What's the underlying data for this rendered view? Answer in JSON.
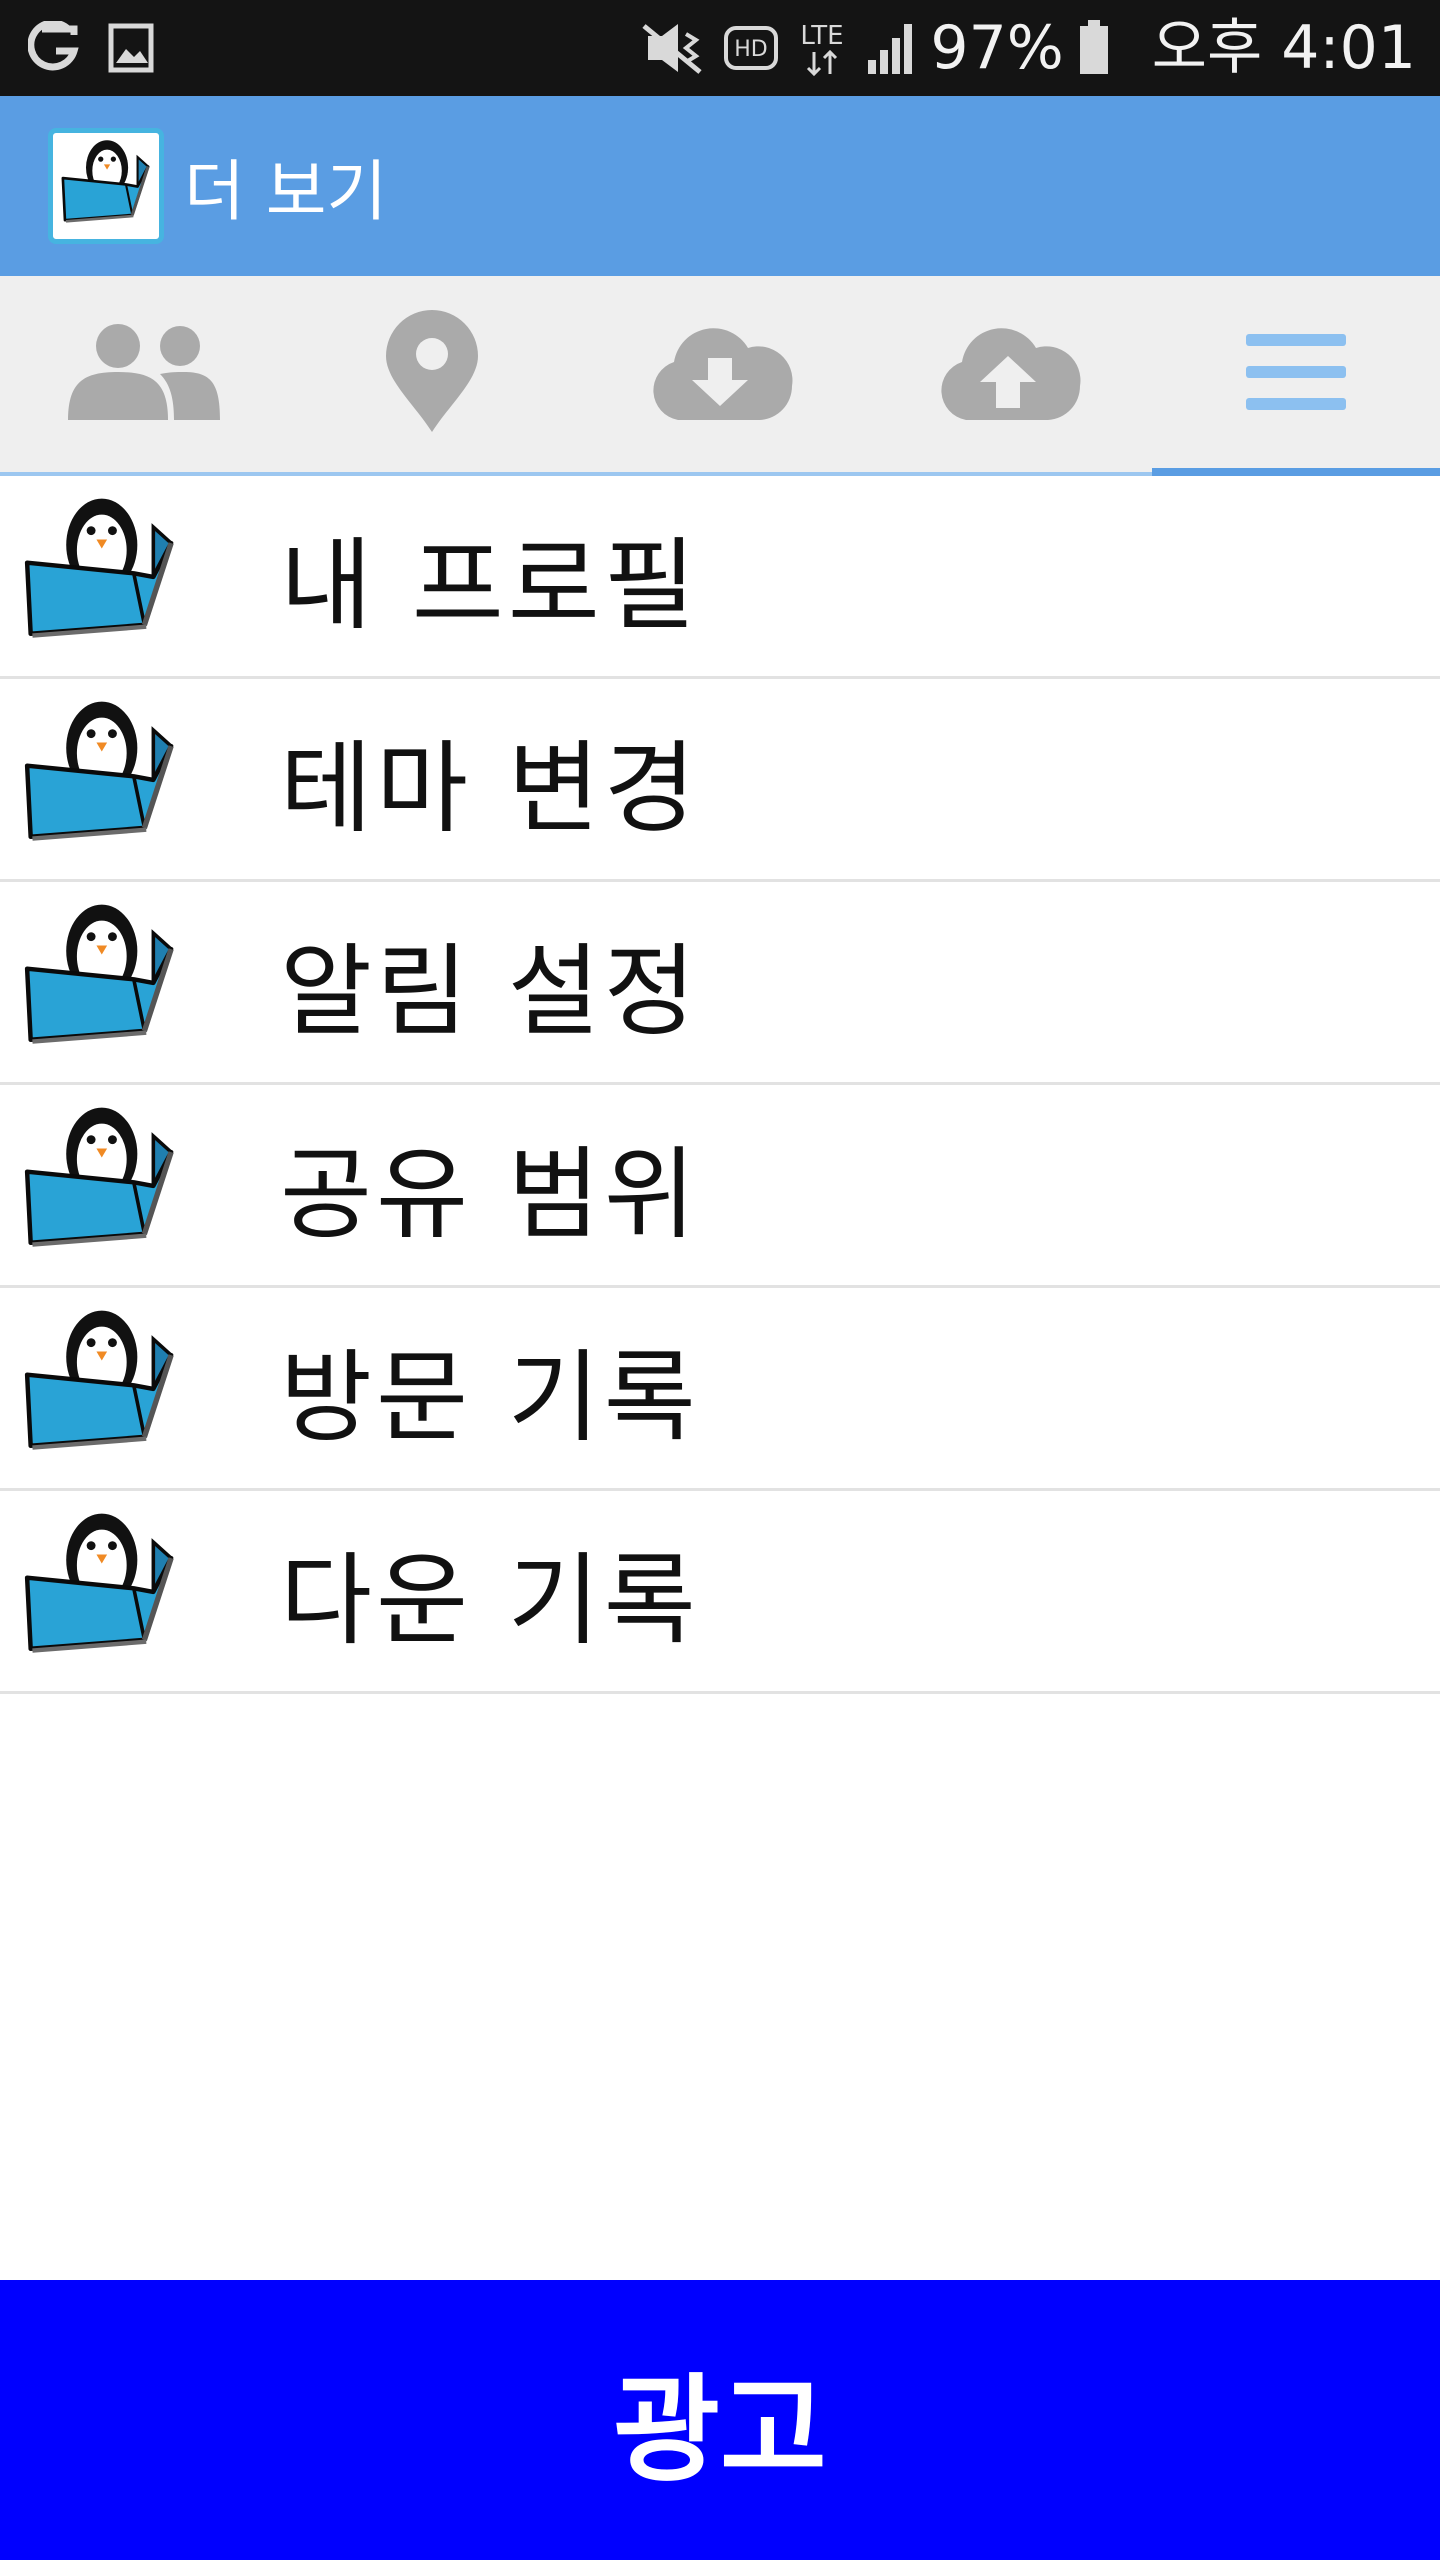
{
  "status_bar": {
    "battery_percent": "97%",
    "time": "오후 4:01",
    "icons": [
      "notification-g-icon",
      "gallery-icon",
      "mute-icon",
      "hd-icon",
      "lte-icon",
      "signal-icon",
      "battery-icon"
    ]
  },
  "app_bar": {
    "title": "더 보기",
    "logo_icon": "penguin-box-icon",
    "color": "#5a9de3"
  },
  "tabs": [
    {
      "icon": "people-icon",
      "active": false
    },
    {
      "icon": "location-pin-icon",
      "active": false
    },
    {
      "icon": "cloud-download-icon",
      "active": false
    },
    {
      "icon": "cloud-upload-icon",
      "active": false
    },
    {
      "icon": "menu-icon",
      "active": true
    }
  ],
  "menu": {
    "items": [
      {
        "label": "내 프로필",
        "icon": "penguin-box-icon"
      },
      {
        "label": "테마 변경",
        "icon": "penguin-box-icon"
      },
      {
        "label": "알림 설정",
        "icon": "penguin-box-icon"
      },
      {
        "label": "공유 범위",
        "icon": "penguin-box-icon"
      },
      {
        "label": "방문 기록",
        "icon": "penguin-box-icon"
      },
      {
        "label": "다운 기록",
        "icon": "penguin-box-icon"
      }
    ]
  },
  "ad": {
    "label": "광고",
    "color": "#0000ff"
  }
}
